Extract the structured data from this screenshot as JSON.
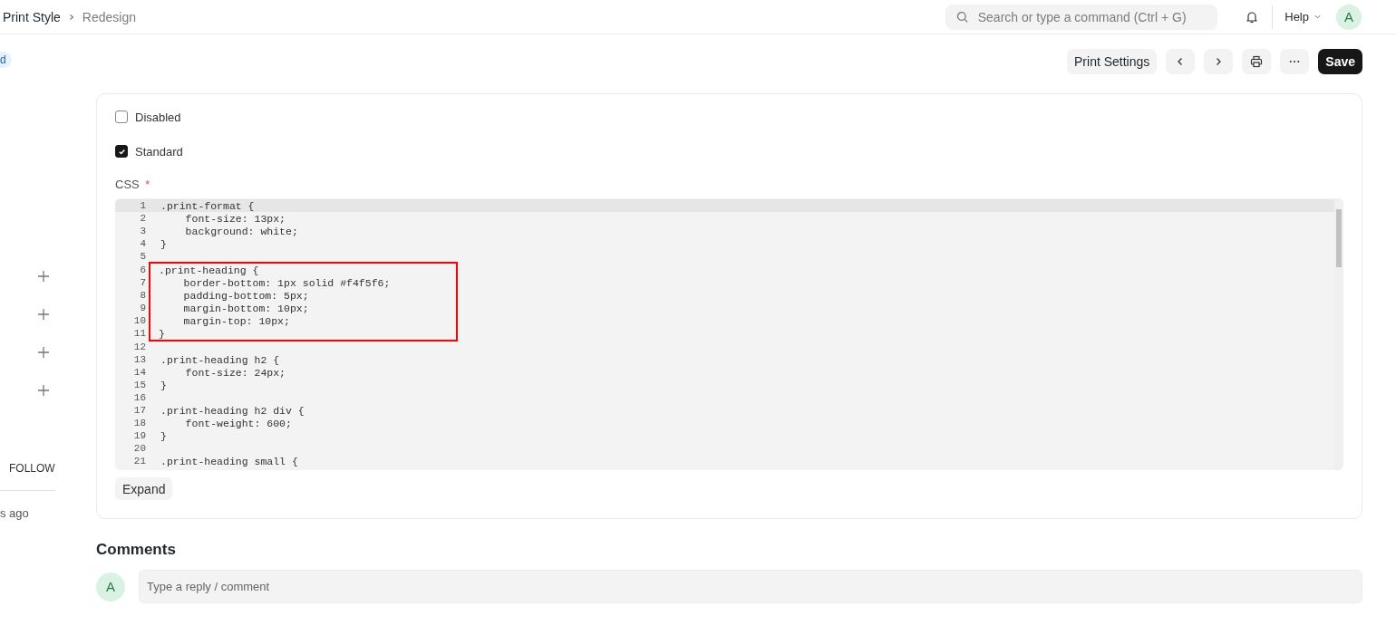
{
  "breadcrumbs": [
    {
      "label": "Print Style",
      "current": false
    },
    {
      "label": "Redesign",
      "current": true
    }
  ],
  "search": {
    "placeholder": "Search or type a command (Ctrl + G)"
  },
  "help": {
    "label": "Help"
  },
  "user": {
    "initial": "A"
  },
  "sidebar": {
    "pill": "d",
    "follow": "FOLLOW",
    "time": "s ago"
  },
  "toolbar": {
    "print_settings": "Print Settings",
    "save": "Save"
  },
  "fields": [
    {
      "label": "Disabled",
      "checked": false
    },
    {
      "label": "Standard",
      "checked": true
    }
  ],
  "editor": {
    "label": "CSS",
    "required_mark": "*",
    "lines": [
      {
        "number": "1",
        "code": ".print-format {",
        "active": true,
        "highlighted": false
      },
      {
        "number": "2",
        "code": "    font-size: 13px;",
        "active": false,
        "highlighted": false
      },
      {
        "number": "3",
        "code": "    background: white;",
        "active": false,
        "highlighted": false
      },
      {
        "number": "4",
        "code": "}",
        "active": false,
        "highlighted": false
      },
      {
        "number": "5",
        "active": false,
        "highlighted": false
      },
      {
        "number": "6",
        "code": ".print-heading {",
        "active": false,
        "highlighted": true
      },
      {
        "number": "7",
        "code": "    border-bottom: 1px solid #f4f5f6;",
        "active": false,
        "highlighted": true
      },
      {
        "number": "8",
        "code": "    padding-bottom: 5px;",
        "active": false,
        "highlighted": true
      },
      {
        "number": "9",
        "code": "    margin-bottom: 10px;",
        "active": false,
        "highlighted": true
      },
      {
        "number": "10",
        "code": "    margin-top: 10px;",
        "active": false,
        "highlighted": true
      },
      {
        "number": "11",
        "code": "}",
        "active": false,
        "highlighted": true
      },
      {
        "number": "12",
        "active": false,
        "highlighted": false
      },
      {
        "number": "13",
        "code": ".print-heading h2 {",
        "active": false,
        "highlighted": false
      },
      {
        "number": "14",
        "code": "    font-size: 24px;",
        "active": false,
        "highlighted": false
      },
      {
        "number": "15",
        "code": "}",
        "active": false,
        "highlighted": false
      },
      {
        "number": "16",
        "active": false,
        "highlighted": false
      },
      {
        "number": "17",
        "code": ".print-heading h2 div {",
        "active": false,
        "highlighted": false
      },
      {
        "number": "18",
        "code": "    font-weight: 600;",
        "active": false,
        "highlighted": false
      },
      {
        "number": "19",
        "code": "}",
        "active": false,
        "highlighted": false
      },
      {
        "number": "20",
        "active": false,
        "highlighted": false
      },
      {
        "number": "21",
        "code": ".print-heading small {",
        "active": false,
        "highlighted": false
      }
    ],
    "expand": "Expand"
  },
  "comments": {
    "title": "Comments",
    "avatar": "A",
    "placeholder": "Type a reply / comment"
  }
}
